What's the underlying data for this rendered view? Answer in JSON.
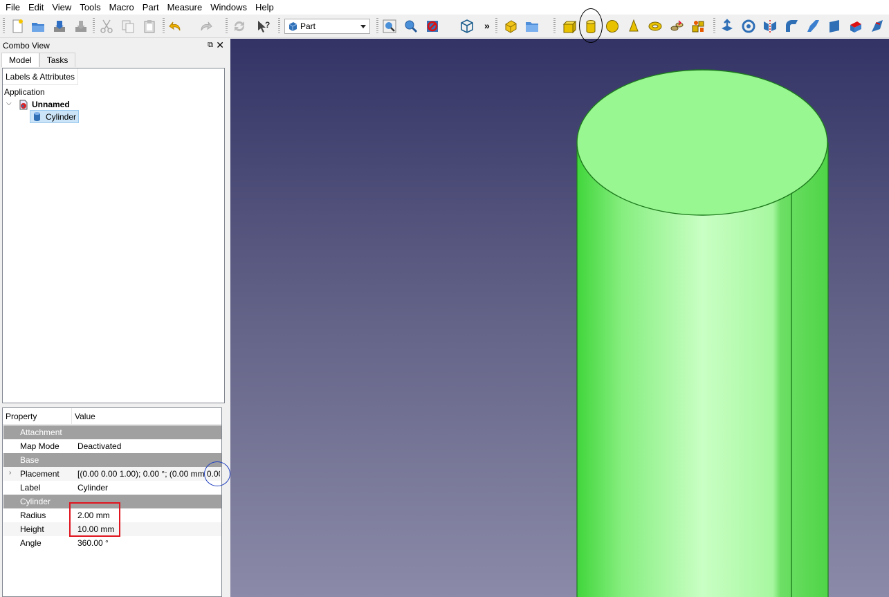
{
  "menu": [
    "File",
    "Edit",
    "View",
    "Tools",
    "Macro",
    "Part",
    "Measure",
    "Windows",
    "Help"
  ],
  "toolbar": {
    "workbench": "Part",
    "more": "»",
    "icons": [
      "new-file-icon",
      "open-file-icon",
      "save-icon",
      "save-as-icon",
      "cut-icon",
      "copy-icon",
      "paste-icon",
      "undo-icon",
      "redo-icon",
      "refresh-icon",
      "whats-this-icon",
      "fit-all-icon",
      "fit-selection-icon",
      "draw-style-icon",
      "isometric-view-icon",
      "create-part-icon",
      "create-group-icon",
      "box-icon",
      "cylinder-icon",
      "sphere-icon",
      "cone-icon",
      "torus-icon",
      "tube-icon",
      "primitives-icon",
      "extrude-icon",
      "revolve-icon",
      "mirror-icon",
      "fillet-icon",
      "chamfer-icon",
      "make-face-icon",
      "ruled-surface-icon",
      "loft-icon"
    ]
  },
  "combo": {
    "title": "Combo View",
    "float_glyph": "⧉",
    "close_glyph": "✕",
    "tabs": [
      "Model",
      "Tasks"
    ],
    "tree_header": "Labels & Attributes",
    "application_label": "Application",
    "document_label": "Unnamed",
    "object_label": "Cylinder",
    "toggle_glyph": "⌵"
  },
  "properties": {
    "header": {
      "property": "Property",
      "value": "Value"
    },
    "expander_glyph": "›",
    "rows": [
      {
        "kind": "group",
        "name": "Attachment"
      },
      {
        "kind": "prop",
        "name": "Map Mode",
        "value": "Deactivated"
      },
      {
        "kind": "group",
        "name": "Base"
      },
      {
        "kind": "prop",
        "name": "Placement",
        "value": "[(0.00 0.00 1.00); 0.00 °; (0.00 mm  0.00...",
        "expandable": true
      },
      {
        "kind": "prop",
        "name": "Label",
        "value": "Cylinder"
      },
      {
        "kind": "group",
        "name": "Cylinder"
      },
      {
        "kind": "prop",
        "name": "Radius",
        "value": "2.00 mm"
      },
      {
        "kind": "prop",
        "name": "Height",
        "value": "10.00 mm"
      },
      {
        "kind": "prop",
        "name": "Angle",
        "value": "360.00 °"
      }
    ]
  },
  "colors": {
    "viewport_top": "#333366",
    "viewport_bottom": "#8b8aa8",
    "cylinder_face": "#98f790",
    "cylinder_edge": "#1d7a1d",
    "selection_bg": "#cce4f7",
    "group_row": "#a0a0a0",
    "annotation_red": "#e0141e",
    "annotation_blue": "#1f3fbf",
    "annotation_black": "#000000"
  }
}
